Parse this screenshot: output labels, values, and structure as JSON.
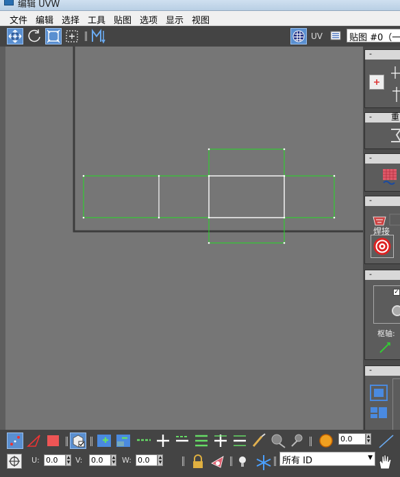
{
  "window": {
    "title": "编辑 UVW"
  },
  "menu": {
    "items": [
      "文件",
      "编辑",
      "选择",
      "工具",
      "贴图",
      "选项",
      "显示",
      "视图"
    ]
  },
  "toolbar": {
    "uv_label": "UV",
    "map_select": "贴图 #0（一"
  },
  "right_panel": {
    "section2_title": "重",
    "weld_label": "焊接",
    "pivot_label": "枢轴:"
  },
  "bottom": {
    "spinner_value": "0.0",
    "u_label": "U:",
    "u_value": "0.0",
    "v_label": "V:",
    "v_value": "0.0",
    "w_label": "W:",
    "w_value": "0.0",
    "id_filter": "所有 ID"
  },
  "colors": {
    "uv_edge": "#22dd22",
    "selected_face": "#ffffff",
    "viewport_bg": "#767676",
    "active_tool": "#5a8fd0"
  }
}
